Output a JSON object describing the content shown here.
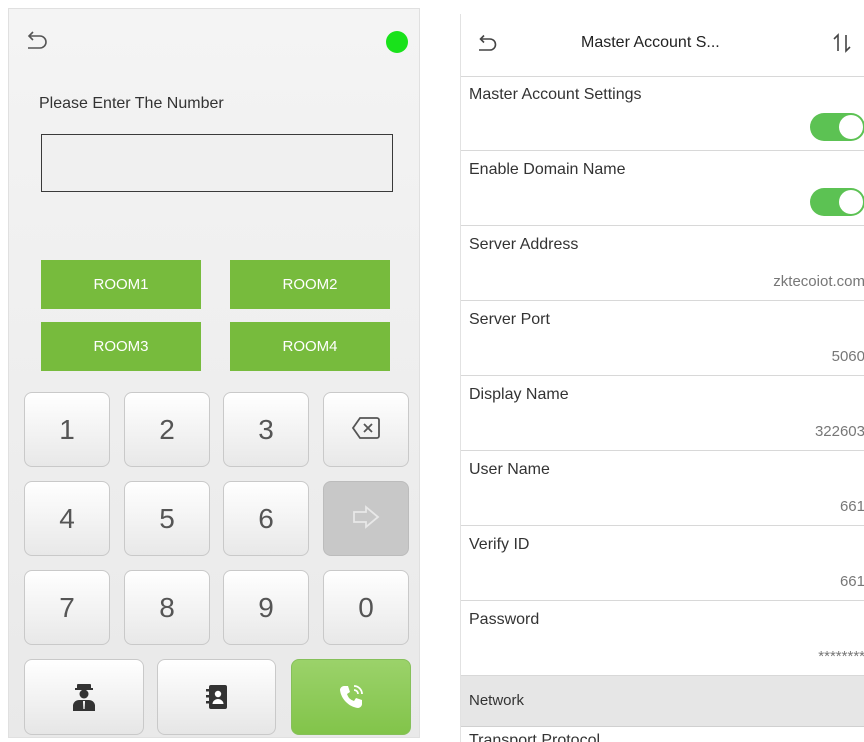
{
  "dial": {
    "prompt": "Please Enter The Number",
    "input_value": "",
    "rooms": [
      "ROOM1",
      "ROOM2",
      "ROOM3",
      "ROOM4"
    ],
    "keys": [
      "1",
      "2",
      "3",
      "4",
      "5",
      "6",
      "7",
      "8",
      "9",
      "0"
    ],
    "status_color": "#19e21b",
    "icons": {
      "back": "back-arrow-icon",
      "backspace": "backspace-icon",
      "enter": "arrow-right-icon",
      "admin": "security-guard-icon",
      "contacts": "contacts-book-icon",
      "call": "phone-call-icon"
    }
  },
  "settings": {
    "title": "Master Account S...",
    "icons": {
      "back": "back-arrow-icon",
      "sort": "sort-icon"
    },
    "rows": [
      {
        "label": "Master Account Settings",
        "type": "toggle",
        "on": true
      },
      {
        "label": "Enable Domain Name",
        "type": "toggle",
        "on": true
      },
      {
        "label": "Server Address",
        "value": "zktecoiot.com"
      },
      {
        "label": "Server Port",
        "value": "5060"
      },
      {
        "label": "Display Name",
        "value": "322603"
      },
      {
        "label": "User Name",
        "value": "661"
      },
      {
        "label": "Verify ID",
        "value": "661"
      },
      {
        "label": "Password",
        "value": "********"
      }
    ],
    "section": "Network",
    "next_row": "Transport Protocol",
    "accent_color": "#5cc253"
  }
}
